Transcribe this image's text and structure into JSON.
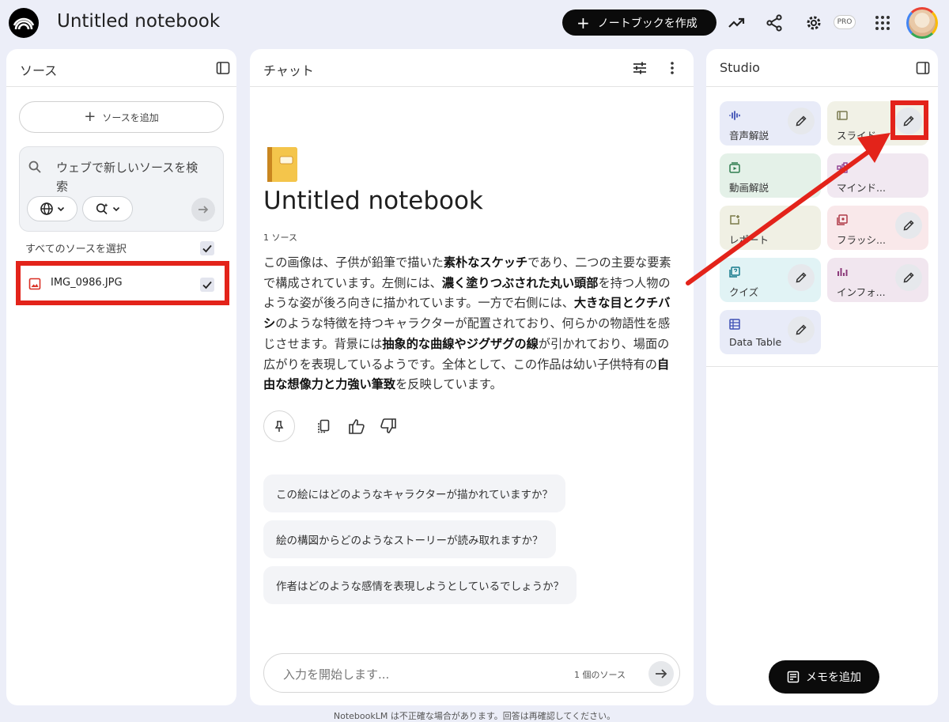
{
  "header": {
    "title": "Untitled notebook",
    "create_label": "ノートブックを作成",
    "pro_badge": "PRO"
  },
  "sources": {
    "title": "ソース",
    "add_label": "ソースを追加",
    "search_placeholder": "ウェブで新しいソースを検索",
    "select_all_label": "すべてのソースを選択",
    "items": [
      {
        "name": "IMG_0986.JPG"
      }
    ]
  },
  "chat": {
    "title": "チャット",
    "notebook_title": "Untitled notebook",
    "source_count": "1 ソース",
    "summary": [
      {
        "t": "この画像は、子供が鉛筆で描いた",
        "b": false
      },
      {
        "t": "素朴なスケッチ",
        "b": true
      },
      {
        "t": "であり、二つの主要な要素で構成されています。左側には、",
        "b": false
      },
      {
        "t": "濃く塗りつぶされた丸い頭部",
        "b": true
      },
      {
        "t": "を持つ人物のような姿が後ろ向きに描かれています。一方で右側には、",
        "b": false
      },
      {
        "t": "大きな目とクチバシ",
        "b": true
      },
      {
        "t": "のような特徴を持つキャラクターが配置されており、何らかの物語性を感じさせます。背景には",
        "b": false
      },
      {
        "t": "抽象的な曲線やジグザグの線",
        "b": true
      },
      {
        "t": "が引かれており、場面の広がりを表現しているようです。全体として、この作品は幼い子供特有の",
        "b": false
      },
      {
        "t": "自由な想像力と力強い筆致",
        "b": true
      },
      {
        "t": "を反映しています。",
        "b": false
      }
    ],
    "suggestions": [
      "この絵にはどのようなキャラクターが描かれていますか？",
      "絵の構図からどのようなストーリーが読み取れますか？",
      "作者はどのような感情を表現しようとしているでしょうか？"
    ],
    "input_placeholder": "入力を開始します...",
    "input_source_count": "1 個のソース"
  },
  "studio": {
    "title": "Studio",
    "cards": [
      {
        "label": "音声解説",
        "bg": "#e8ebf8",
        "icon": "waveform-icon",
        "color": "#3f51b5"
      },
      {
        "label": "スライド...",
        "bg": "#f1f1e6",
        "icon": "slides-icon",
        "color": "#7a7a50"
      },
      {
        "label": "動画解説",
        "bg": "#e4f1e8",
        "icon": "video-icon",
        "color": "#2e7d4f"
      },
      {
        "label": "マインド...",
        "bg": "#f1e8f1",
        "icon": "mindmap-icon",
        "color": "#8e3c8e"
      },
      {
        "label": "レポート",
        "bg": "#f0f0e4",
        "icon": "report-icon",
        "color": "#7b7b4a"
      },
      {
        "label": "フラッシ...",
        "bg": "#f9e8ea",
        "icon": "flashcard-icon",
        "color": "#b03a48"
      },
      {
        "label": "クイズ",
        "bg": "#e1f3f5",
        "icon": "quiz-icon",
        "color": "#167a8c"
      },
      {
        "label": "インフォ...",
        "bg": "#f1e6ef",
        "icon": "infographic-icon",
        "color": "#8b3a7a"
      },
      {
        "label": "Data Table",
        "bg": "#e8ebf8",
        "icon": "table-icon",
        "color": "#3f51b5"
      }
    ],
    "memo_label": "メモを追加"
  },
  "footer": {
    "disclaimer": "NotebookLM は不正確な場合があります。回答は再確認してください。"
  },
  "colors": {
    "accent": "#0b0b0b",
    "highlight": "#e3231a",
    "background": "#eceef8"
  }
}
